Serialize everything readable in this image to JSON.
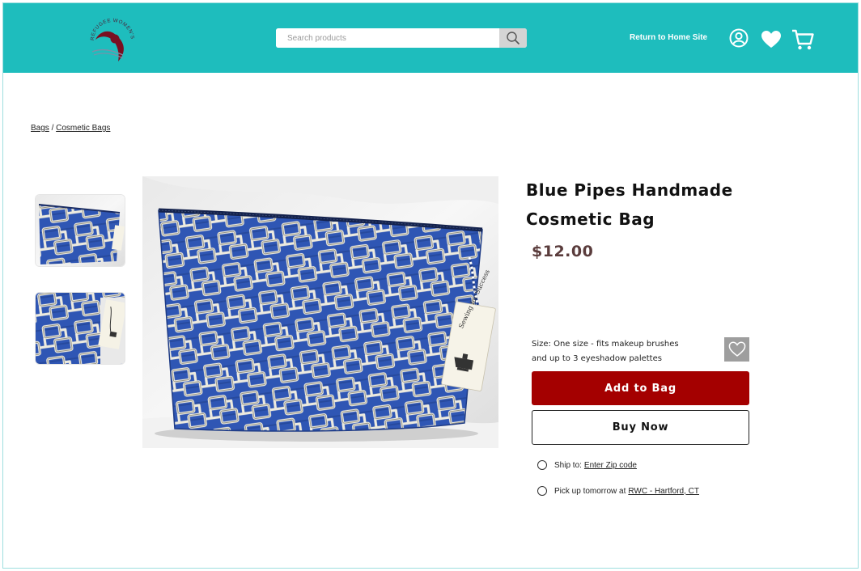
{
  "header": {
    "logo_text": "REFUGEE WOMEN'S CENTER",
    "search": {
      "placeholder": "Search products",
      "value": ""
    },
    "return_link": "Return to Home Site",
    "icons": [
      "user-icon",
      "heart-icon",
      "cart-icon",
      "search-icon"
    ]
  },
  "breadcrumb": {
    "items": [
      "Bags",
      "Cosmetic Bags"
    ],
    "separator": "/"
  },
  "gallery": {
    "thumbnails": [
      {
        "alt": "bag-front-thumbnail"
      },
      {
        "alt": "bag-closeup-thumbnail"
      }
    ],
    "tag_text": "Sewing for Success"
  },
  "product": {
    "title_line1": "Blue Pipes Handmade",
    "title_line2": "Cosmetic Bag",
    "price": "$12.00",
    "size_line1": "Size: One size - fits makeup brushes",
    "size_line2": "and up to 3 eyeshadow palettes",
    "add_to_bag": "Add to Bag",
    "buy_now": "Buy Now"
  },
  "fulfillment": {
    "ship_label": "Ship to:",
    "ship_link": "Enter Zip code",
    "pickup_label": "Pick up tomorrow at",
    "pickup_link": "RWC - Hartford, CT"
  },
  "colors": {
    "header_bg": "#1ebdbd",
    "add_button": "#a40000",
    "price": "#5a3c3c",
    "bag_blue": "#2f56b4"
  }
}
